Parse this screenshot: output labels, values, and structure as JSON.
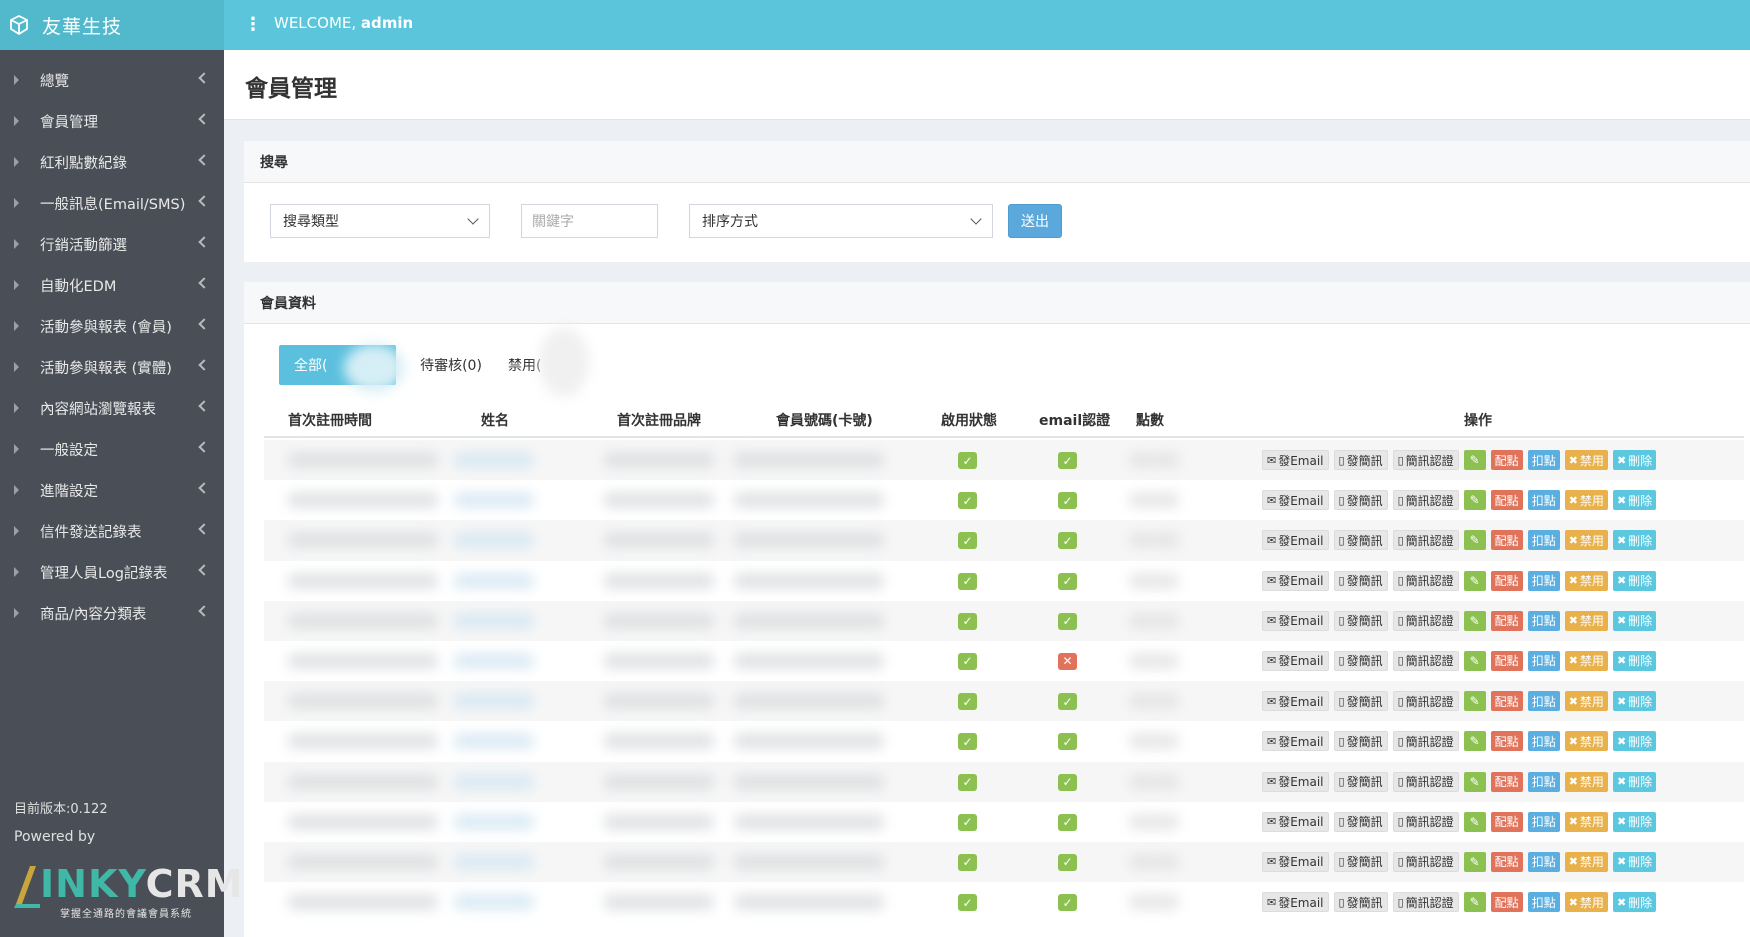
{
  "app": {
    "name": "友華生技",
    "welcome_prefix": "WELCOME,",
    "user": "admin"
  },
  "sidebar": {
    "items": [
      {
        "label": "總覽"
      },
      {
        "label": "會員管理"
      },
      {
        "label": "紅利點數紀錄"
      },
      {
        "label": "一般訊息(Email/SMS)"
      },
      {
        "label": "行銷活動篩選"
      },
      {
        "label": "自動化EDM"
      },
      {
        "label": "活動參與報表 (會員)"
      },
      {
        "label": "活動參與報表 (實體)"
      },
      {
        "label": "內容網站瀏覽報表"
      },
      {
        "label": "一般設定"
      },
      {
        "label": "進階設定"
      },
      {
        "label": "信件發送記錄表"
      },
      {
        "label": "管理人員Log記錄表"
      },
      {
        "label": "商品/內容分類表"
      }
    ],
    "version": "目前版本:0.122",
    "powered_by": "Powered by",
    "brand": {
      "prefix": "INKY",
      "suffix": "CRM",
      "tagline": "掌握全通路的會議會員系統"
    }
  },
  "page": {
    "title": "會員管理"
  },
  "search": {
    "heading": "搜尋",
    "type_select": "搜尋類型",
    "keyword_placeholder": "關鍵字",
    "sort_select": "排序方式",
    "submit": "送出"
  },
  "members": {
    "heading": "會員資料",
    "tabs": {
      "all": "全部(",
      "pending": "待審核(0)",
      "disabled": "禁用("
    },
    "columns": {
      "reg_time": "首次註冊時間",
      "name": "姓名",
      "brand": "首次註冊品牌",
      "member_no": "會員號碼(卡號)",
      "active": "啟用狀態",
      "email_verified": "email認證",
      "points": "點數",
      "actions": "操作"
    },
    "actions": {
      "email": "發Email",
      "sms": "發簡訊",
      "sms_verify": "簡訊認證",
      "add_points": "配點",
      "deduct_points": "扣點",
      "disable": "禁用",
      "delete": "刪除"
    },
    "rows": [
      {
        "active": true,
        "email_verified": true
      },
      {
        "active": true,
        "email_verified": true
      },
      {
        "active": true,
        "email_verified": true
      },
      {
        "active": true,
        "email_verified": true
      },
      {
        "active": true,
        "email_verified": true
      },
      {
        "active": true,
        "email_verified": false
      },
      {
        "active": true,
        "email_verified": true
      },
      {
        "active": true,
        "email_verified": true
      },
      {
        "active": true,
        "email_verified": true
      },
      {
        "active": true,
        "email_verified": true
      },
      {
        "active": true,
        "email_verified": true
      },
      {
        "active": true,
        "email_verified": true
      }
    ]
  },
  "colors": {
    "topbar": "#5bc6db",
    "sidebar": "#4a4f57",
    "check_ok": "#8cc152",
    "check_bad": "#e0735a"
  }
}
